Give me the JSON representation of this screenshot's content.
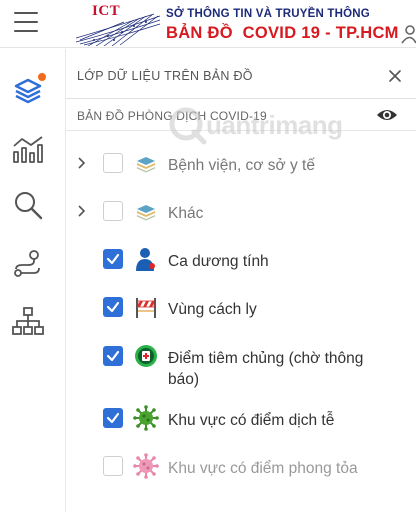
{
  "header": {
    "menu_icon": "hamburger-menu-icon",
    "logo_text": "ICT",
    "line1": "SỞ THÔNG TIN VÀ TRUYỀN THÔNG",
    "line2": "BẢN ĐỒ  COVID 19 - TP.HCM",
    "brand_red": "#d71920",
    "brand_blue": "#1c2a7a"
  },
  "rail": {
    "items": [
      {
        "name": "layers-icon",
        "active": true,
        "has_notification": true
      },
      {
        "name": "chart-line-icon",
        "active": false
      },
      {
        "name": "search-icon",
        "active": false
      },
      {
        "name": "route-icon",
        "active": false
      },
      {
        "name": "org-tree-icon",
        "active": false
      }
    ],
    "accent": "#2f6fd8",
    "notification_color": "#f26a1b"
  },
  "panel": {
    "title": "LỚP DỮ LIỆU TRÊN BẢN ĐỒ",
    "close_icon": "close-icon",
    "group": {
      "title": "BẢN ĐỒ PHÒNG DỊCH COVID-19",
      "visibility_icon": "eye-icon"
    },
    "layers": [
      {
        "label": "Bệnh viện, cơ sở y tế",
        "checked": false,
        "expandable": true,
        "icon": "layer-stack-icon"
      },
      {
        "label": "Khác",
        "checked": false,
        "expandable": true,
        "icon": "layer-stack-icon"
      },
      {
        "label": "Ca dương tính",
        "checked": true,
        "expandable": false,
        "icon": "positive-case-person-icon"
      },
      {
        "label": "Vùng cách ly",
        "checked": true,
        "expandable": false,
        "icon": "quarantine-barrier-icon"
      },
      {
        "label": "Điểm tiêm chủng (chờ thông báo)",
        "checked": true,
        "expandable": false,
        "icon": "vaccination-point-icon"
      },
      {
        "label": "Khu vực có điểm dịch tễ",
        "checked": true,
        "expandable": false,
        "icon": "virus-green-icon"
      },
      {
        "label": "Khu vực có điểm phong tỏa",
        "checked": false,
        "expandable": false,
        "icon": "virus-pink-icon"
      }
    ],
    "checkbox_color": "#2f6fd8"
  },
  "watermark": {
    "text": "uantrimang"
  }
}
